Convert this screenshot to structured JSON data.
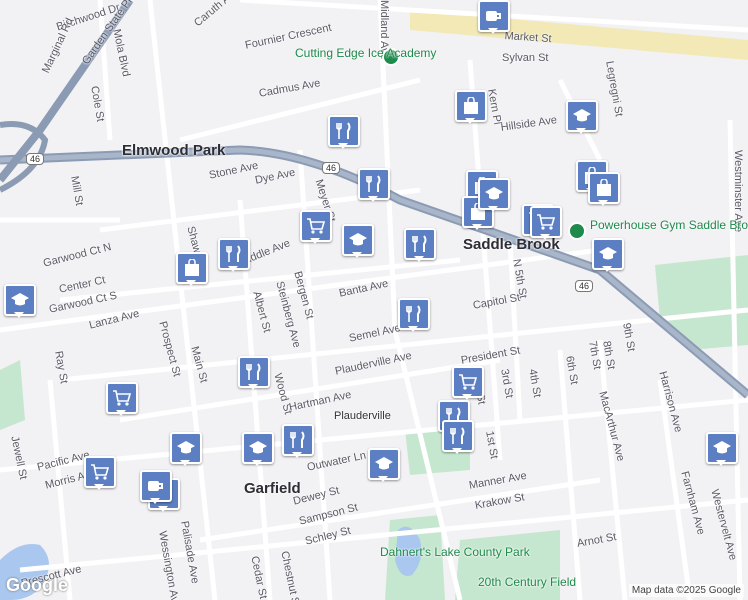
{
  "map": {
    "places": [
      "Elmwood Park",
      "Saddle Brook",
      "Garfield"
    ],
    "streets": [
      "Birchwood Dr",
      "Garden State Pkwy",
      "Mola Blvd",
      "Caruth Ave",
      "Marginal Rd",
      "Fournier Crescent",
      "Cole St",
      "Cadmus Ave",
      "Market St",
      "Sylvan St",
      "Kern Pl",
      "Hillside Ave",
      "Legregni St",
      "Stone Ave",
      "Dye Ave",
      "Meyer St",
      "Mill St",
      "Garwood Ct N",
      "Center Ct",
      "Garwood Ct S",
      "Lanza Ave",
      "Saddle Ave",
      "Shaw Ave",
      "Banta Ave",
      "Bergen St",
      "Albert St",
      "Steinberg Ave",
      "Semel Ave",
      "Plauderville Ave",
      "Prospect St",
      "Main St",
      "Ray St",
      "Wood St",
      "Hartman Ave",
      "Outwater Ln",
      "Pacific Ave",
      "Morris Ave",
      "Jewell St",
      "Palisade Ave",
      "Wessington Ave",
      "Dewey St",
      "Sampson St",
      "Schley St",
      "Manner Ave",
      "Krakow St",
      "Arnot St",
      "Capitol St",
      "President St",
      "2nd St",
      "3rd St",
      "4th St",
      "6th St",
      "7th St",
      "8th St",
      "9th St",
      "1st St",
      "N 5th St",
      "MacArthur Ave",
      "Harrison Ave",
      "Farnham Ave",
      "Westminster Ave",
      "Westervelt Ave",
      "Chestnut St",
      "Cedar St",
      "Midland Ave",
      "Prescott Ave"
    ],
    "shields": [
      "46",
      "46",
      "46"
    ],
    "pois": [
      "Cutting Edge Ice Academy",
      "Powerhouse Gym Saddle Brook",
      "Plauderville",
      "Dahnert's Lake County Park",
      "20th Century Field"
    ],
    "attribution": "Map data ©2025 Google",
    "logo": "Google",
    "colors": {
      "highway": "#8b9bb4",
      "pin": "#5b7fc2",
      "park": "#c6e7cf",
      "water": "#a9c7ef",
      "rail": "#f1e7a8"
    },
    "pins": [
      {
        "icon": "coffee-icon"
      },
      {
        "icon": "shopping-bag-icon"
      },
      {
        "icon": "school-icon"
      },
      {
        "icon": "restaurant-icon"
      },
      {
        "icon": "restaurant-icon"
      },
      {
        "icon": "shopping-cart-icon"
      },
      {
        "icon": "school-icon"
      },
      {
        "icon": "restaurant-icon"
      },
      {
        "icon": "shopping-bag-icon"
      },
      {
        "icon": "restaurant-icon"
      },
      {
        "icon": "school-icon"
      },
      {
        "icon": "restaurant-icon"
      },
      {
        "icon": "restaurant-icon"
      },
      {
        "icon": "shopping-cart-icon"
      },
      {
        "icon": "shopping-cart-icon"
      },
      {
        "icon": "school-icon"
      },
      {
        "icon": "restaurant-icon"
      },
      {
        "icon": "school-icon"
      },
      {
        "icon": "restaurant-icon"
      },
      {
        "icon": "restaurant-icon"
      },
      {
        "icon": "school-icon"
      },
      {
        "icon": "shopping-cart-icon"
      },
      {
        "icon": "coffee-icon"
      },
      {
        "icon": "coffee-icon"
      },
      {
        "icon": "school-icon"
      },
      {
        "icon": "shopping-bag-icon"
      },
      {
        "icon": "shopping-bag-icon"
      },
      {
        "icon": "shopping-bag-icon"
      },
      {
        "icon": "shopping-cart-icon"
      },
      {
        "icon": "school-icon"
      },
      {
        "icon": "shopping-bag-icon"
      },
      {
        "icon": "shopping-cart-icon"
      },
      {
        "icon": "school-icon"
      }
    ]
  }
}
